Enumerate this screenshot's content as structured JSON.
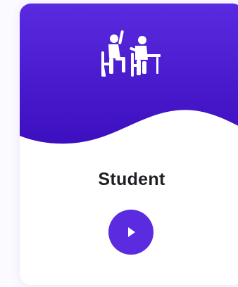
{
  "card": {
    "title": "Student",
    "icon": "students-at-desk-icon",
    "action_icon": "play-icon"
  },
  "colors": {
    "gradient_top": "#5a2ae0",
    "gradient_bottom": "#3c0fbf",
    "button": "#5b2be0",
    "title_text": "#1f1f24"
  }
}
